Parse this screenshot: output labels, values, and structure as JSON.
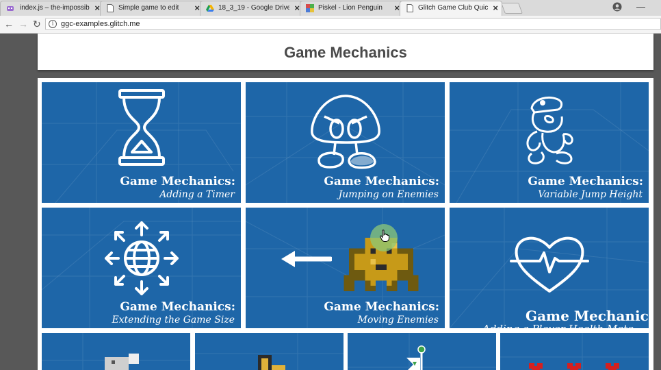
{
  "browser": {
    "tabs": [
      {
        "title": "index.js – the-impossible",
        "favicon": "glitch-icon",
        "close": "×"
      },
      {
        "title": "Simple game to edit",
        "favicon": "page-icon",
        "close": "×"
      },
      {
        "title": "18_3_19 - Google Drive",
        "favicon": "drive-icon",
        "close": "×"
      },
      {
        "title": "Piskel - Lion Penguin",
        "favicon": "piskel-icon",
        "close": "×"
      },
      {
        "title": "Glitch Game Club Quick I",
        "favicon": "page-icon",
        "close": "×"
      }
    ],
    "url": "ggc-examples.glitch.me",
    "info_glyph": "i"
  },
  "page": {
    "title": "Game Mechanics",
    "cards": [
      {
        "title": "Game Mechanics:",
        "subtitle": "Adding a Timer",
        "icon": "hourglass-icon"
      },
      {
        "title": "Game Mechanics:",
        "subtitle": "Jumping on Enemies",
        "icon": "goomba-icon"
      },
      {
        "title": "Game Mechanics:",
        "subtitle": "Variable Jump Height",
        "icon": "mario-icon"
      },
      {
        "title": "Game Mechanics:",
        "subtitle": "Extending the Game Size",
        "icon": "globe-arrows-icon"
      },
      {
        "title": "Game Mechanics:",
        "subtitle": "Moving Enemies",
        "icon": "pixel-enemy-icon"
      },
      {
        "title": "Game Mechanic",
        "subtitle": "Adding a Player Health Mete",
        "icon": "heart-pulse-icon"
      }
    ]
  },
  "colors": {
    "card_blue": "#1e66a8",
    "page_bg": "#585858",
    "cursor_highlight": "#8cc878"
  }
}
